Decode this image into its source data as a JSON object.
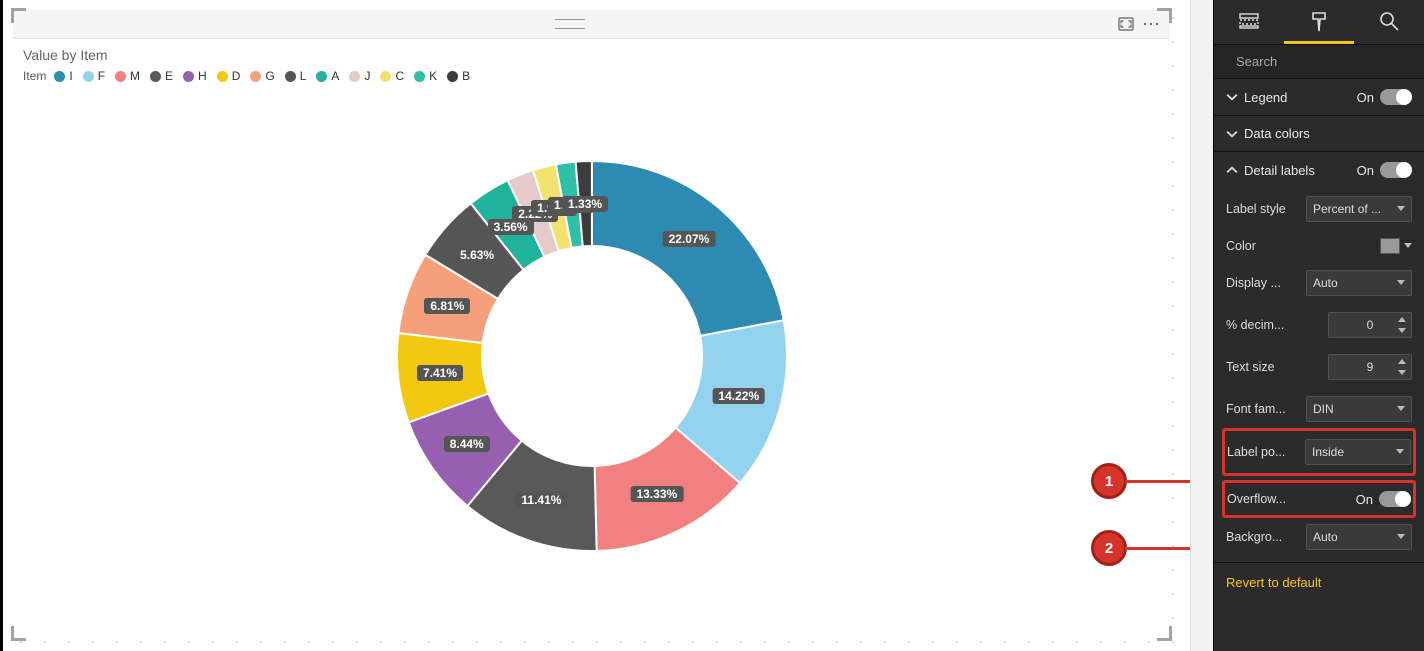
{
  "chart": {
    "title": "Value by Item",
    "legend_label": "Item",
    "items": [
      {
        "id": "I",
        "color": "#2d8ab0"
      },
      {
        "id": "F",
        "color": "#93d3ef"
      },
      {
        "id": "M",
        "color": "#f28080"
      },
      {
        "id": "E",
        "color": "#595959"
      },
      {
        "id": "H",
        "color": "#965fb0"
      },
      {
        "id": "D",
        "color": "#f2c811"
      },
      {
        "id": "G",
        "color": "#f5a07a"
      },
      {
        "id": "L",
        "color": "#565656"
      },
      {
        "id": "A",
        "color": "#1fb39b"
      },
      {
        "id": "J",
        "color": "#e6c9c9"
      },
      {
        "id": "C",
        "color": "#f2e26d"
      },
      {
        "id": "K",
        "color": "#2fbfa5"
      },
      {
        "id": "B",
        "color": "#3c3c3c"
      }
    ]
  },
  "chart_data": {
    "type": "pie",
    "title": "Value by Item",
    "value_unit": "percent",
    "total_percent": 100,
    "series": [
      {
        "name": "I",
        "value": 22.07
      },
      {
        "name": "F",
        "value": 14.22
      },
      {
        "name": "M",
        "value": 13.33
      },
      {
        "name": "E",
        "value": 11.41
      },
      {
        "name": "H",
        "value": 8.44
      },
      {
        "name": "D",
        "value": 7.41
      },
      {
        "name": "G",
        "value": 6.81
      },
      {
        "name": "L",
        "value": 5.63
      },
      {
        "name": "A",
        "value": 3.56
      },
      {
        "name": "J",
        "value": 2.22
      },
      {
        "name": "C",
        "value": 1.93
      },
      {
        "name": "K",
        "value": 1.63
      },
      {
        "name": "B",
        "value": 1.33
      }
    ],
    "legend": {
      "position": "top-left"
    },
    "label_style": "percent",
    "label_position": "inside",
    "overflow_text": true
  },
  "panel": {
    "search_placeholder": "Search",
    "cards": {
      "legend": {
        "label": "Legend",
        "expanded": false,
        "on": true,
        "on_text": "On"
      },
      "data_colors": {
        "label": "Data colors",
        "expanded": false
      },
      "detail_labels": {
        "label": "Detail labels",
        "expanded": true,
        "on": true,
        "on_text": "On",
        "rows": {
          "label_style": {
            "label": "Label style",
            "value": "Percent of ..."
          },
          "color": {
            "label": "Color",
            "value": "#999999"
          },
          "display_units": {
            "label": "Display ...",
            "value": "Auto"
          },
          "decimal": {
            "label": "% decim...",
            "value": "0"
          },
          "text_size": {
            "label": "Text size",
            "value": "9"
          },
          "font_family": {
            "label": "Font fam...",
            "value": "DIN"
          },
          "label_position": {
            "label": "Label po...",
            "value": "Inside"
          },
          "overflow_text": {
            "label": "Overflow...",
            "on": true,
            "on_text": "On"
          },
          "background": {
            "label": "Backgro...",
            "value": "Auto"
          }
        }
      }
    },
    "revert": "Revert to default"
  },
  "callouts": {
    "b1": "1",
    "b2": "2"
  }
}
